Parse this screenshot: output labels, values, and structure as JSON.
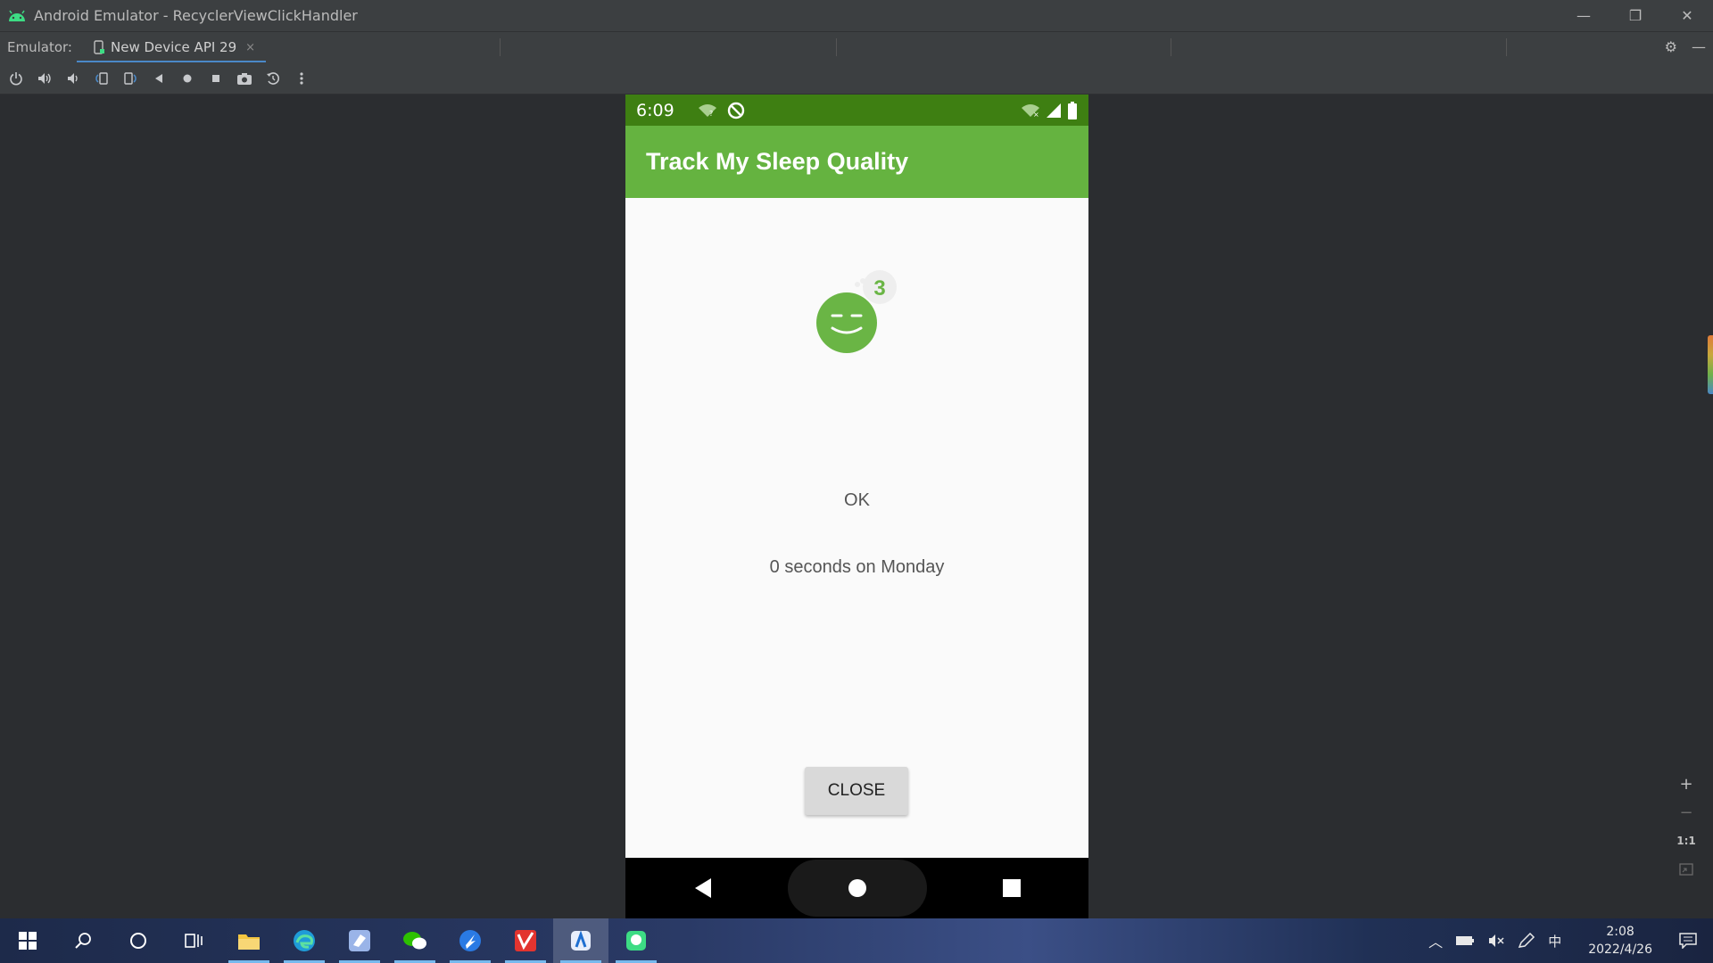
{
  "window": {
    "title": "Android Emulator - RecyclerViewClickHandler",
    "icons": [
      "android-icon",
      "minimize-icon",
      "restore-icon",
      "close-icon"
    ]
  },
  "emulator_bar": {
    "label": "Emulator:",
    "tab_label": "New Device API 29",
    "tab_close": "×"
  },
  "toolbar": {
    "tools": [
      "power",
      "volume-up",
      "volume-down",
      "rotate-left",
      "rotate-right",
      "back",
      "home",
      "overview",
      "screenshot",
      "snapshot",
      "more"
    ]
  },
  "device": {
    "status_bar": {
      "time": "6:09"
    },
    "app_bar": {
      "title": "Track My Sleep Quality"
    },
    "detail": {
      "sleep_quality_badge": "3",
      "quality_label": "OK",
      "duration_label": "0 seconds on Monday",
      "close_button": "CLOSE"
    },
    "colors": {
      "status_bar": "#3e7f12",
      "app_bar": "#65b340",
      "icon": "#6ab545"
    }
  },
  "zoom_controls": {
    "zoom_in": "+",
    "zoom_out": "−",
    "actual_size": "1:1"
  },
  "taskbar": {
    "clock_time": "2:08",
    "clock_date": "2022/4/26",
    "ime": "中"
  }
}
